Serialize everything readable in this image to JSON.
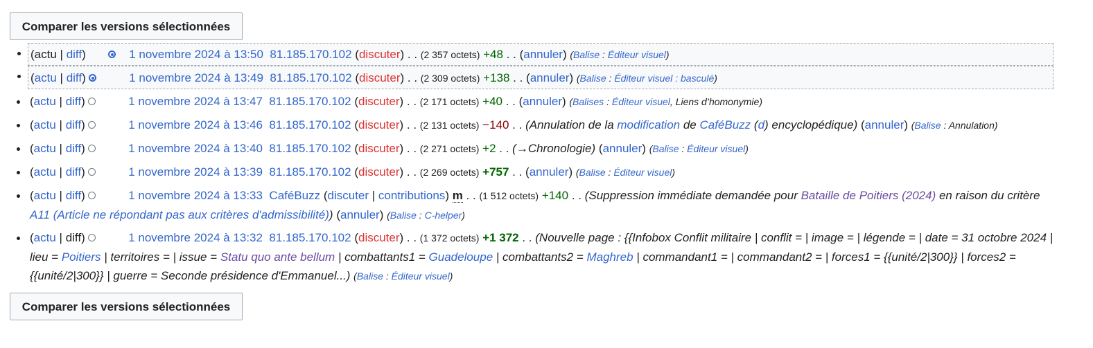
{
  "compare_button_label": "Comparer les versions sélectionnées",
  "rows": [
    {
      "actu": "actu",
      "diff": "diff",
      "date": "1 novembre 2024 à 13:50",
      "user": "81.185.170.102",
      "talk": "discuter",
      "size": "(2 357 octets)",
      "delta": "+48",
      "undo": "annuler",
      "tag_prefix": "Balise",
      "tags": "Éditeur visuel"
    },
    {
      "actu": "actu",
      "diff": "diff",
      "date": "1 novembre 2024 à 13:49",
      "user": "81.185.170.102",
      "talk": "discuter",
      "size": "(2 309 octets)",
      "delta": "+138",
      "undo": "annuler",
      "tag_prefix": "Balise",
      "tags": "Éditeur visuel : basculé"
    },
    {
      "actu": "actu",
      "diff": "diff",
      "date": "1 novembre 2024 à 13:47",
      "user": "81.185.170.102",
      "talk": "discuter",
      "size": "(2 171 octets)",
      "delta": "+40",
      "undo": "annuler",
      "tag_prefix": "Balises",
      "tags": "Éditeur visuel",
      "tags_extra": "Liens d’homonymie"
    },
    {
      "actu": "actu",
      "diff": "diff",
      "date": "1 novembre 2024 à 13:46",
      "user": "81.185.170.102",
      "talk": "discuter",
      "size": "(2 131 octets)",
      "delta": "−140",
      "summary_pre": "Annulation de la ",
      "summary_link1": "modification",
      "summary_mid": " de ",
      "summary_link2": "CaféBuzz",
      "summary_link3": "d",
      "summary_post": " encyclopédique",
      "undo": "annuler",
      "tag_prefix": "Balise",
      "tags": "Annulation"
    },
    {
      "actu": "actu",
      "diff": "diff",
      "date": "1 novembre 2024 à 13:40",
      "user": "81.185.170.102",
      "talk": "discuter",
      "size": "(2 271 octets)",
      "delta": "+2",
      "summary": "→Chronologie",
      "undo": "annuler",
      "tag_prefix": "Balise",
      "tags": "Éditeur visuel"
    },
    {
      "actu": "actu",
      "diff": "diff",
      "date": "1 novembre 2024 à 13:39",
      "user": "81.185.170.102",
      "talk": "discuter",
      "size": "(2 269 octets)",
      "delta": "+757",
      "undo": "annuler",
      "tag_prefix": "Balise",
      "tags": "Éditeur visuel"
    },
    {
      "actu": "actu",
      "diff": "diff",
      "date": "1 novembre 2024 à 13:33",
      "user": "CaféBuzz",
      "talk": "discuter",
      "contribs": "contributions",
      "minor": "m",
      "size": "(1 512 octets)",
      "delta": "+140",
      "summary_pre": "Suppression immédiate demandée pour ",
      "summary_link1": "Bataille de Poitiers (2024)",
      "summary_mid": " en raison du critère ",
      "summary_link2": "A11 (Article ne répondant pas aux critères d'admissibilité)",
      "undo": "annuler",
      "tag_prefix": "Balise",
      "tags": "C-helper"
    },
    {
      "actu": "actu",
      "diff": "diff",
      "date": "1 novembre 2024 à 13:32",
      "user": "81.185.170.102",
      "talk": "discuter",
      "size": "(1 372 octets)",
      "delta": "+1 372",
      "summary_p1": "Nouvelle page : {{Infobox Conflit militaire | conflit = | image = | légende = | date = 31 octobre 2024 | lieu = ",
      "summary_l1": "Poitiers",
      "summary_p2": " | territoires = | issue = ",
      "summary_l2": "Statu quo ante bellum",
      "summary_p3": " | combattants1 = ",
      "summary_l3": "Guadeloupe",
      "summary_p4": " | combattants2 = ",
      "summary_l4": "Maghreb",
      "summary_p5": " | commandant1 = | commandant2 = | forces1 = {{unité/2|300}} | forces2 = {{unité/2|300}} | guerre = Seconde présidence d'Emmanuel...",
      "tag_prefix": "Balise",
      "tags": "Éditeur visuel"
    }
  ]
}
